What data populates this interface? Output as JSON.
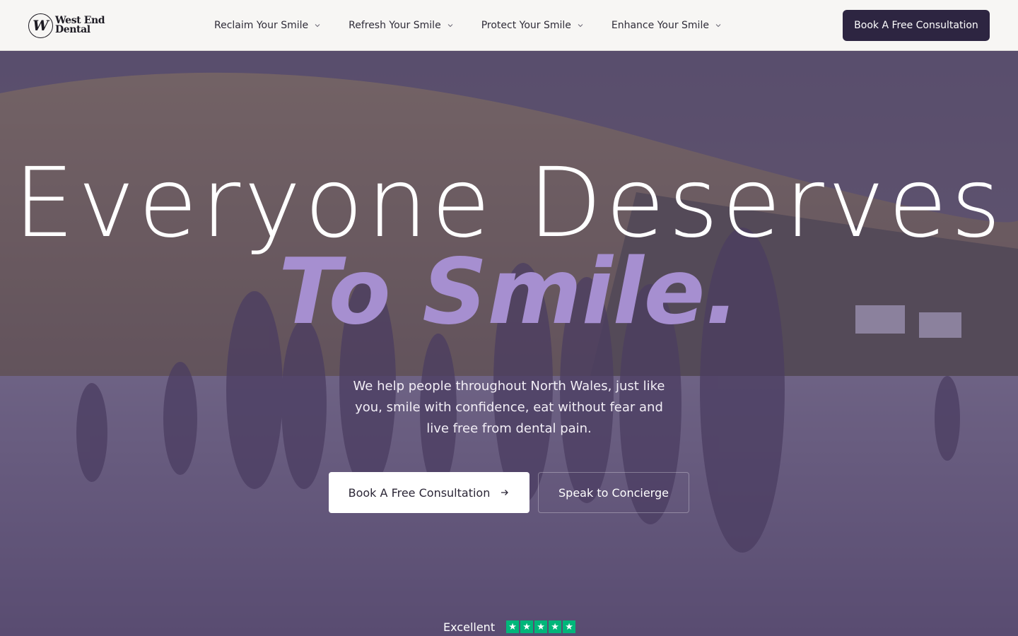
{
  "brand": {
    "name_line1": "West End",
    "name_line2": "Dental",
    "monogram": "W"
  },
  "nav": {
    "items": [
      {
        "label": "Reclaim Your Smile",
        "icon": "chevron-down-icon"
      },
      {
        "label": "Refresh Your Smile",
        "icon": "chevron-down-icon"
      },
      {
        "label": "Protect Your Smile",
        "icon": "chevron-down-icon"
      },
      {
        "label": "Enhance Your Smile",
        "icon": "chevron-down-icon"
      }
    ],
    "cta_label": "Book A Free Consultation"
  },
  "hero": {
    "headline_line1": "Everyone Deserves",
    "headline_line2": "To Smile.",
    "subcopy": "We help people throughout North Wales, just like you, smile with confidence, eat without fear and live free from dental pain.",
    "primary_button": "Book A Free Consultation",
    "primary_button_icon": "arrow-right-icon",
    "secondary_button": "Speak to Concierge",
    "background_image": "family-walking-on-beach-photo"
  },
  "rating": {
    "label": "Excellent",
    "stars": 5,
    "icon": "trustpilot-star-icon"
  },
  "colors": {
    "nav_background": "#f7f6f4",
    "cta_background": "#2d2541",
    "accent_purple": "#a68fd0",
    "hero_overlay": "#3e305c",
    "star_green": "#00b67a"
  }
}
